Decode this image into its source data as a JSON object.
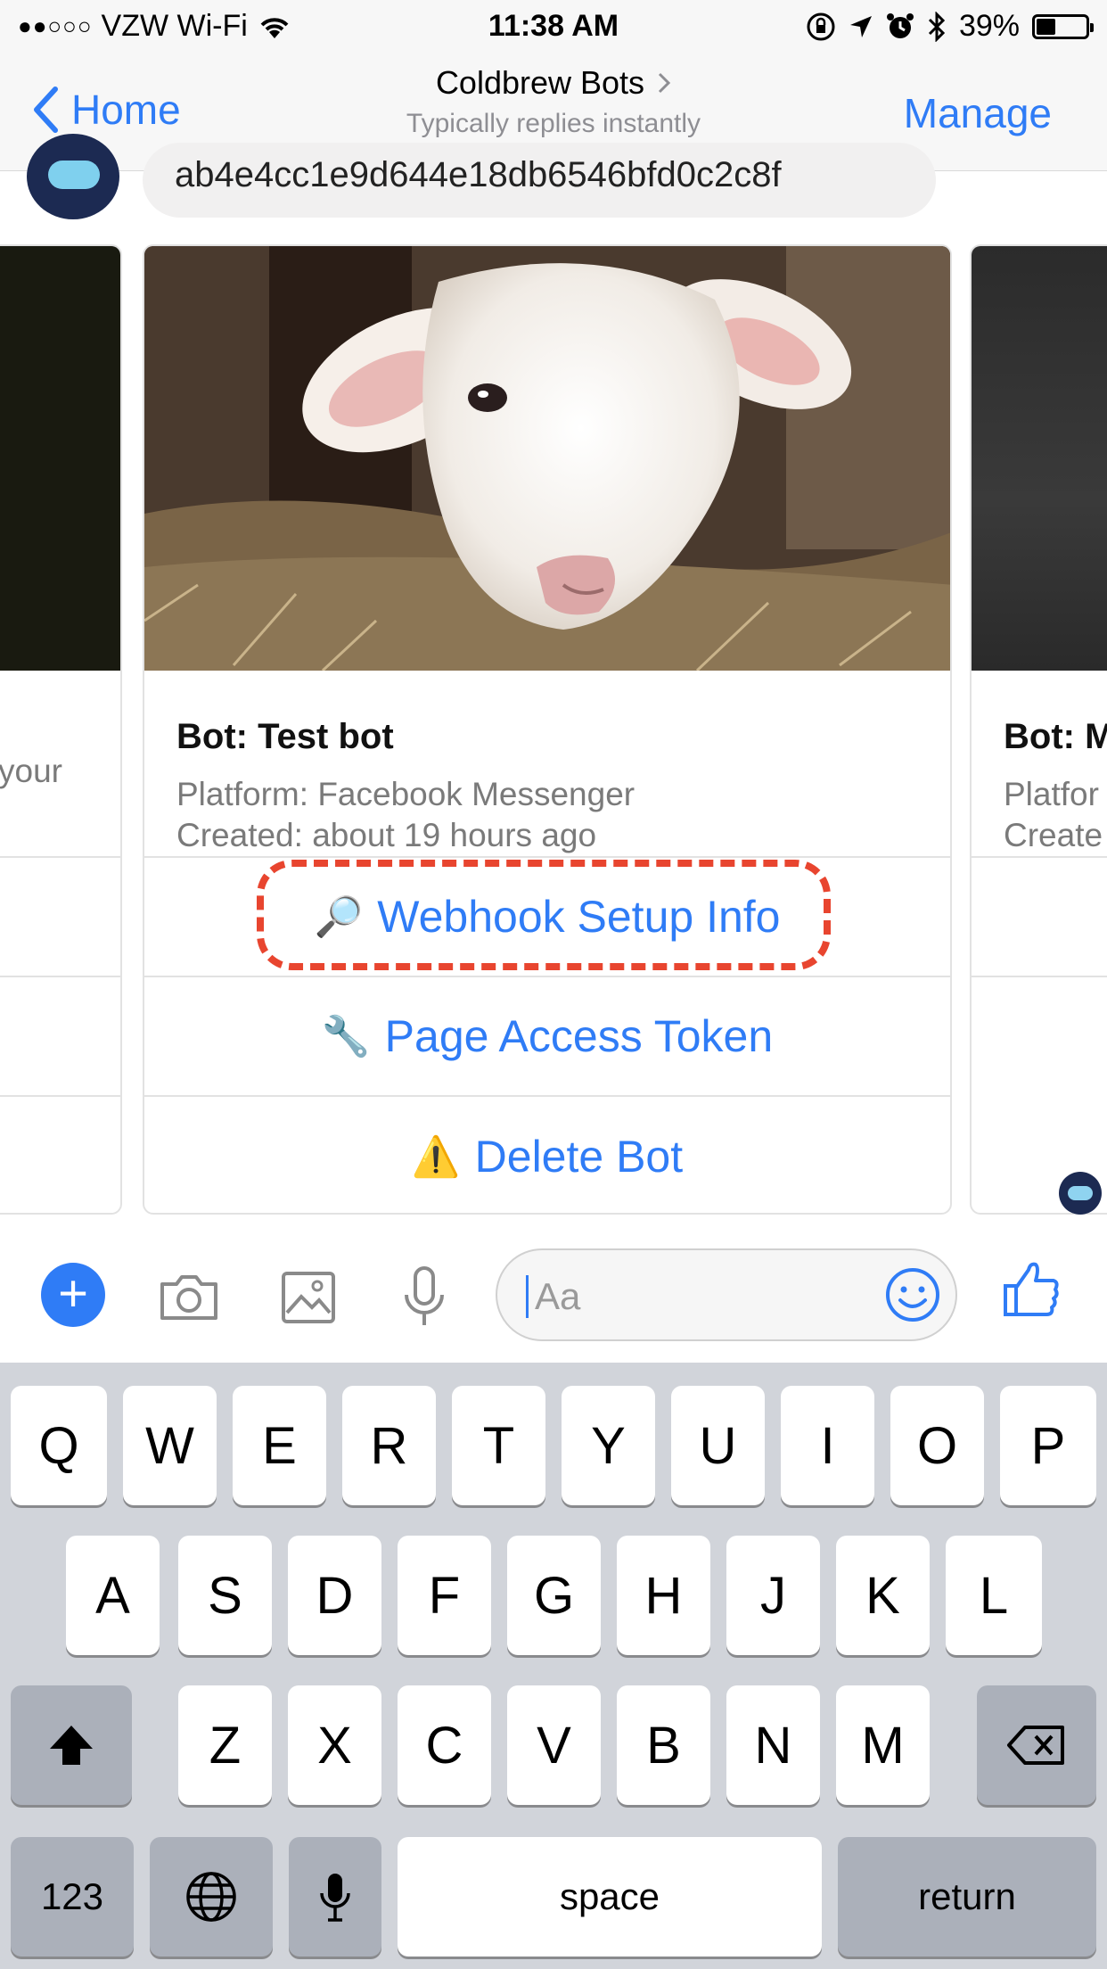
{
  "status_bar": {
    "signal": "●●○○○",
    "carrier": "VZW Wi-Fi",
    "time": "11:38 AM",
    "battery": "39%",
    "battery_level": 0.39,
    "icons": [
      "wifi-icon",
      "rotation-lock-icon",
      "location-icon",
      "alarm-icon",
      "bluetooth-icon",
      "battery-icon"
    ]
  },
  "nav": {
    "back_label": "Home",
    "title": "Coldbrew Bots",
    "subtitle": "Typically replies instantly",
    "manage_label": "Manage"
  },
  "conversation": {
    "partial_message": "ab4e4cc1e9d644e18db6546bfd0c2c8f"
  },
  "cards": {
    "left": {
      "title": "",
      "desc_fragment": "your"
    },
    "main": {
      "title": "Bot: Test bot",
      "platform": "Platform: Facebook Messenger",
      "created": "Created: about 19 hours ago",
      "buttons": [
        {
          "label": "Webhook Setup Info",
          "icon": "🔎"
        },
        {
          "label": "Page Access Token",
          "icon": "🔧"
        },
        {
          "label": "Delete Bot",
          "icon": "⚠️"
        }
      ]
    },
    "right": {
      "title": "Bot: M",
      "platform": "Platfor",
      "created": "Create"
    }
  },
  "composer": {
    "placeholder": "Aa"
  },
  "keyboard": {
    "row1": [
      "Q",
      "W",
      "E",
      "R",
      "T",
      "Y",
      "U",
      "I",
      "O",
      "P"
    ],
    "row2": [
      "A",
      "S",
      "D",
      "F",
      "G",
      "H",
      "J",
      "K",
      "L"
    ],
    "row3": [
      "Z",
      "X",
      "C",
      "V",
      "B",
      "N",
      "M"
    ],
    "num_label": "123",
    "space_label": "space",
    "return_label": "return"
  },
  "colors": {
    "accent": "#2f7cf6",
    "highlight": "#e8452f"
  }
}
